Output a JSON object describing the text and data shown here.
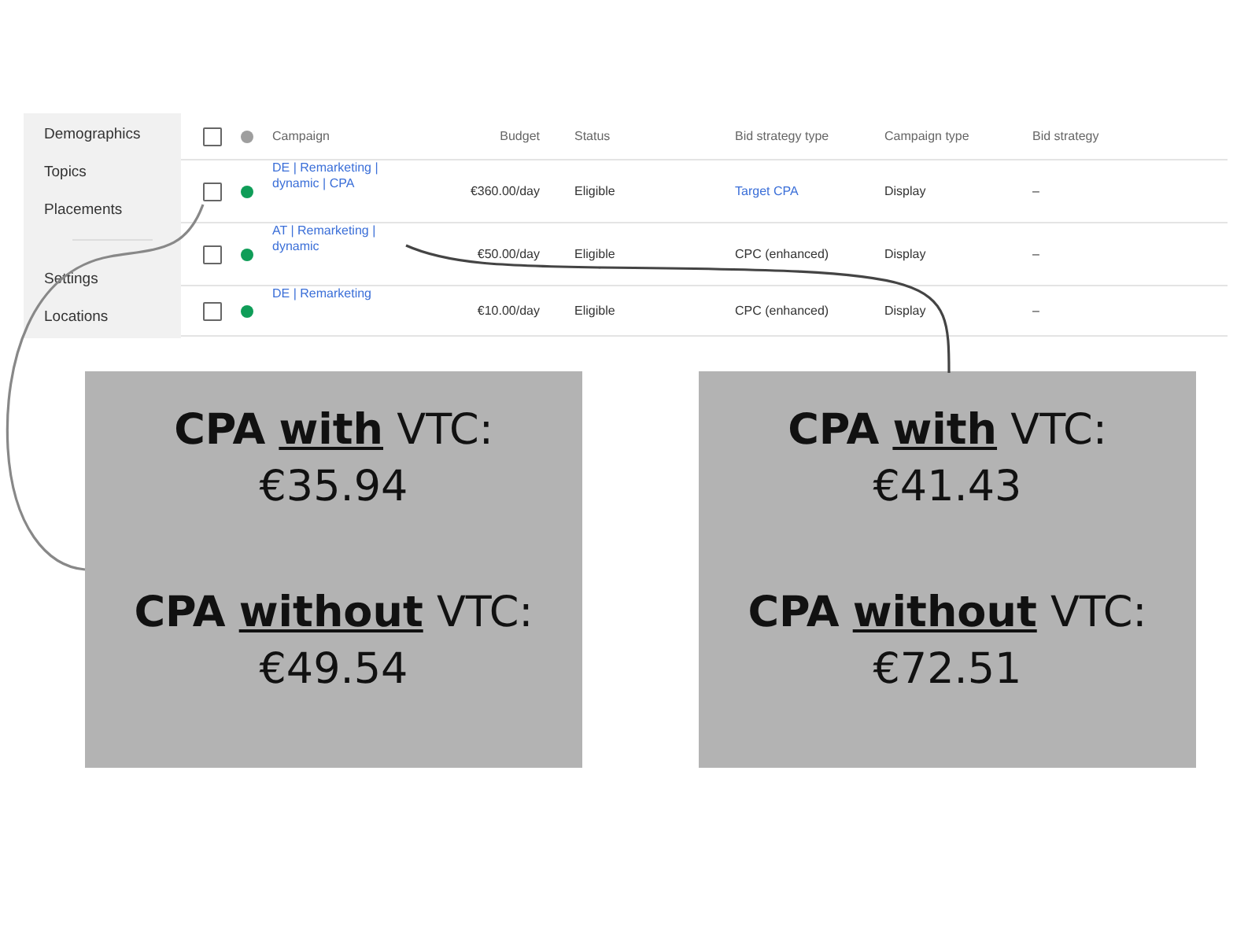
{
  "sidebar": {
    "items": [
      {
        "label": "Demographics",
        "kind": "item"
      },
      {
        "label": "Topics",
        "kind": "item"
      },
      {
        "label": "Placements",
        "kind": "item"
      },
      {
        "kind": "divider"
      },
      {
        "label": "Settings",
        "kind": "item"
      },
      {
        "label": "Locations",
        "kind": "item"
      }
    ]
  },
  "table": {
    "header_checked": false,
    "columns": [
      "Campaign",
      "Budget",
      "Status",
      "Bid strategy type",
      "Campaign type",
      "Bid strategy"
    ],
    "rows": [
      {
        "checked": false,
        "color": "#0f9d58",
        "campaign": "DE | Remarketing | dynamic | CPA",
        "budget": "€360.00/day",
        "status": "Eligible",
        "bid_strategy_type": "Target CPA",
        "bid_strategy_type_link": true,
        "campaign_type": "Display",
        "bid_strategy": "–"
      },
      {
        "checked": false,
        "color": "#0f9d58",
        "campaign": "AT | Remarketing | dynamic",
        "budget": "€50.00/day",
        "status": "Eligible",
        "bid_strategy_type": "CPC (enhanced)",
        "bid_strategy_type_link": false,
        "campaign_type": "Display",
        "bid_strategy": "–"
      },
      {
        "checked": false,
        "color": "#0f9d58",
        "campaign": "DE | Remarketing",
        "budget": "€10.00/day",
        "status": "Eligible",
        "bid_strategy_type": "CPC (enhanced)",
        "bid_strategy_type_link": false,
        "campaign_type": "Display",
        "bid_strategy": "–"
      }
    ]
  },
  "callouts": [
    {
      "with_label": "**CPA** **with** VTC:",
      "with_value": "€35.94",
      "without_label": "**CPA** **without** VTC:",
      "without_value": "€49.54"
    },
    {
      "with_label": "**CPA** **with** VTC:",
      "with_value": "€41.43",
      "without_label": "**CPA** **without** VTC:",
      "without_value": "€72.51"
    }
  ]
}
